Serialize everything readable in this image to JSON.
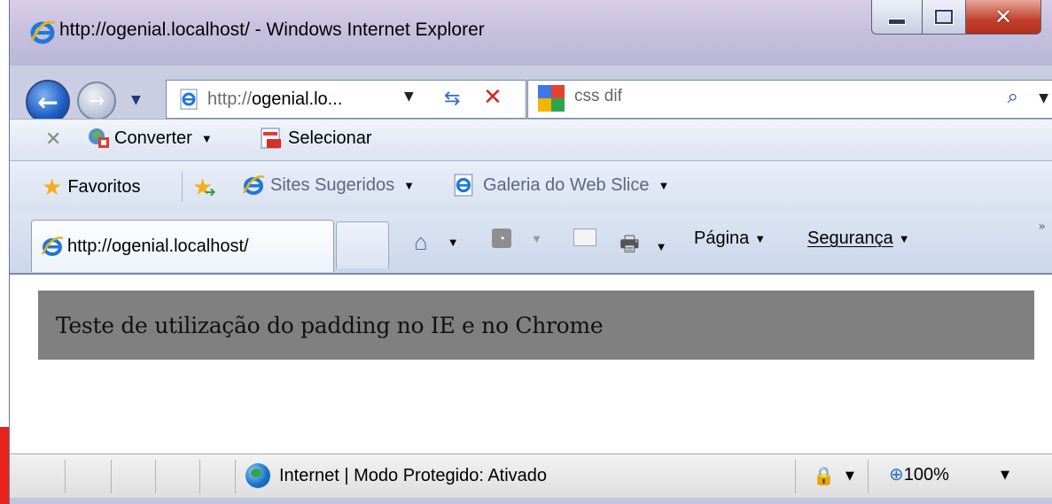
{
  "window": {
    "title": "http://ogenial.localhost/ - Windows Internet Explorer",
    "caption_buttons": [
      "minimize",
      "maximize",
      "close"
    ]
  },
  "nav": {
    "back_icon": "back-arrow-icon",
    "forward_icon": "forward-arrow-icon",
    "address_prefix": "http://",
    "address_host": "ogenial.lo...",
    "search_value": "css dif"
  },
  "command_bar": {
    "converter_label": "Converter",
    "selecionar_label": "Selecionar"
  },
  "favorites_bar": {
    "favoritos_label": "Favoritos",
    "items": [
      {
        "label": "Sites Sugeridos"
      },
      {
        "label": "Galeria do Web Slice"
      }
    ]
  },
  "tabs": {
    "active_tab_label": "http://ogenial.localhost/"
  },
  "toolbar": {
    "pagina_label": "Página",
    "seguranca_label": "Segurança"
  },
  "content": {
    "demo_text": "Teste de utilização do padding no IE e no Chrome",
    "demo_bg": "#808080"
  },
  "status_bar": {
    "zone_text": "Internet | Modo Protegido: Ativado",
    "zoom_text": "100%"
  }
}
